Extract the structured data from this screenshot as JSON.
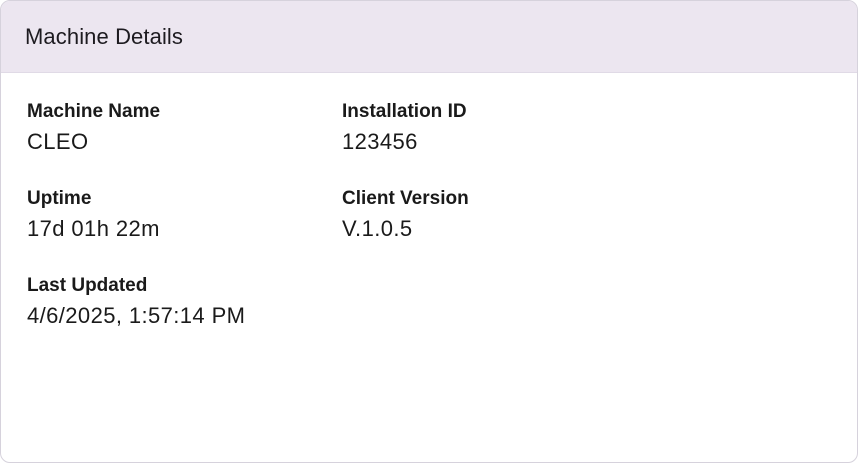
{
  "card": {
    "title": "Machine Details"
  },
  "fields": {
    "machine_name": {
      "label": "Machine Name",
      "value": "CLEO"
    },
    "installation_id": {
      "label": "Installation ID",
      "value": "123456"
    },
    "uptime": {
      "label": "Uptime",
      "value": "17d 01h 22m"
    },
    "client_version": {
      "label": "Client Version",
      "value": "V.1.0.5"
    },
    "last_updated": {
      "label": "Last Updated",
      "value": "4/6/2025, 1:57:14 PM"
    }
  },
  "colors": {
    "header_background": "#ece6f0",
    "card_border": "#d6d2dc",
    "text": "#1a1a1a"
  }
}
